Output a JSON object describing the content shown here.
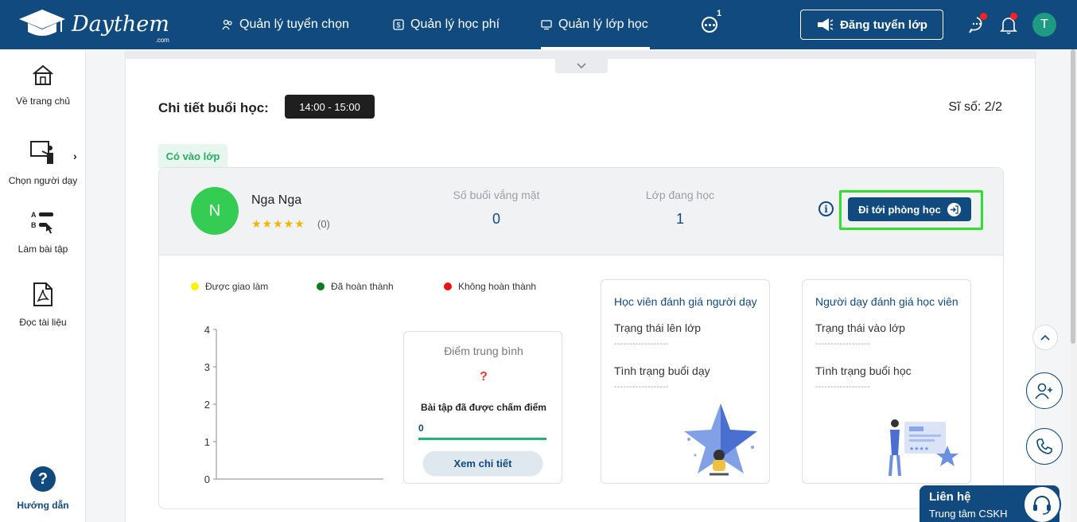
{
  "header": {
    "logo_text": "Daythem",
    "logo_sub": ".com",
    "nav": [
      {
        "label": "Quản lý tuyển chọn"
      },
      {
        "label": "Quản lý học phí"
      },
      {
        "label": "Quản lý lớp học"
      }
    ],
    "more_count": "1",
    "post_button": "Đăng tuyển lớp",
    "avatar_initial": "T"
  },
  "sidebar": {
    "items": [
      {
        "label": "Về trang chủ"
      },
      {
        "label": "Chọn người dạy"
      },
      {
        "label": "Làm bài tập"
      },
      {
        "label": "Đọc tài liệu"
      }
    ],
    "help_label": "Hướng dẫn",
    "help_icon_text": "?"
  },
  "session": {
    "title": "Chi tiết buổi học:",
    "time": "14:00 - 15:00",
    "count": "Sĩ số: 2/2",
    "attend_tab": "Có vào lớp"
  },
  "student": {
    "initial": "N",
    "name": "Nga Nga",
    "stars": "★★★★★",
    "rating": "(0)",
    "absent_label": "Số buổi vắng mặt",
    "absent_value": "0",
    "classes_label": "Lớp đang học",
    "classes_value": "1",
    "info_icon": "i",
    "go_button": "Đi tới phòng học"
  },
  "legend": [
    {
      "label": "Được giao làm",
      "color": "#f5f500"
    },
    {
      "label": "Đã hoàn thành",
      "color": "#0c7a1e"
    },
    {
      "label": "Không hoàn thành",
      "color": "#f01010"
    }
  ],
  "chart_data": {
    "type": "bar",
    "categories": [],
    "series": [],
    "yticks": [
      "0",
      "1",
      "2",
      "3",
      "4"
    ],
    "ylim": [
      0,
      4
    ]
  },
  "avg_card": {
    "title": "Điểm trung bình",
    "value": "?",
    "subtitle": "Bài tập đã được chấm điểm",
    "graded_count": "0",
    "button": "Xem chi tiết"
  },
  "eval_student": {
    "title": "Học viên đánh giá người dạy",
    "field1": "Trạng thái lên lớp",
    "field2": "Tình trạng buổi dạy",
    "dash": "------------------"
  },
  "eval_teacher": {
    "title": "Người dạy đánh giá học viên",
    "field1": "Trạng thái vào lớp",
    "field2": "Tình trạng buổi học",
    "dash": "------------------"
  },
  "contact": {
    "title": "Liên hệ",
    "subtitle": "Trung tâm CSKH"
  },
  "colors": {
    "primary": "#114a7e",
    "highlight": "#2fe02f",
    "success": "#27ae60",
    "avatar_green": "#34cc52"
  }
}
